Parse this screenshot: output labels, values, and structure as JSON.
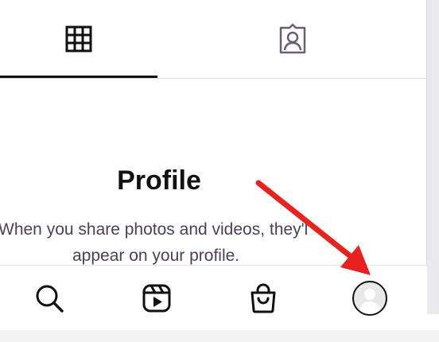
{
  "tabs": [
    {
      "icon": "grid-icon",
      "selected": true
    },
    {
      "icon": "tagged-person-icon",
      "selected": false
    }
  ],
  "empty_state": {
    "title": "Profile",
    "line1": "When you share photos and videos, they'l",
    "line2": "appear on your profile."
  },
  "bottom_nav": [
    {
      "icon": "search-icon"
    },
    {
      "icon": "reels-icon"
    },
    {
      "icon": "shop-bag-icon"
    },
    {
      "icon": "profile-avatar-icon"
    }
  ],
  "colors": {
    "text_primary": "#111111",
    "text_secondary": "#4c3f57",
    "annotation_arrow": "#e8231f"
  }
}
